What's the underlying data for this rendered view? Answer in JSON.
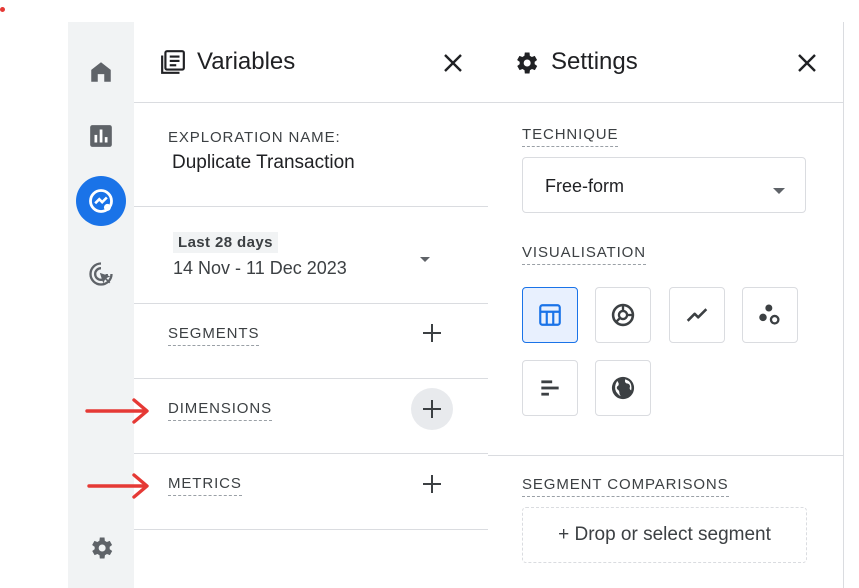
{
  "rail": {
    "items": [
      {
        "icon": "home-icon"
      },
      {
        "icon": "reports-icon"
      },
      {
        "icon": "explore-icon",
        "active": true
      },
      {
        "icon": "advertising-icon"
      },
      {
        "icon": "settings-gear-icon"
      }
    ]
  },
  "variables": {
    "title": "Variables",
    "exploration_name_label": "EXPLORATION NAME:",
    "exploration_name": "Duplicate Transaction",
    "date_range_label": "Last 28 days",
    "date_range": "14 Nov - 11 Dec 2023",
    "segments_label": "SEGMENTS",
    "dimensions_label": "DIMENSIONS",
    "metrics_label": "METRICS"
  },
  "settings": {
    "title": "Settings",
    "technique_label": "TECHNIQUE",
    "technique_value": "Free-form",
    "visualisation_label": "VISUALISATION",
    "visualisations": [
      "table-icon",
      "donut-chart-icon",
      "line-chart-icon",
      "scatter-plot-icon",
      "bar-chart-icon",
      "geo-map-icon"
    ],
    "segment_comparisons_label": "SEGMENT COMPARISONS",
    "drop_segment_label": "+ Drop or select segment"
  },
  "colors": {
    "accent": "#1a73e8",
    "annotation_arrow": "#e53935"
  }
}
